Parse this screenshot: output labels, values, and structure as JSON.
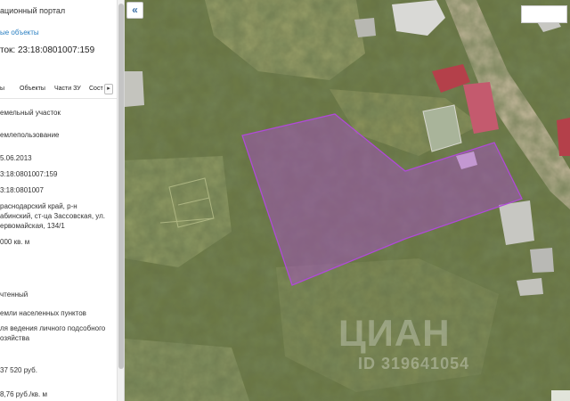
{
  "panel": {
    "portal_title": "ационный портал",
    "nearby_link": "ые объекты",
    "parcel_title": "ток: 23:18:0801007:159",
    "tabs": [
      "ы",
      "Объекты",
      "Части ЗУ",
      "Сост"
    ],
    "tab_scroll_glyph": "▸",
    "fields": [
      "емельный участок",
      "емлепользование",
      "5.06.2013",
      "3:18:0801007:159",
      "3:18:0801007",
      "раснодарский край, р-н",
      "абинский, ст-ца Зассовская, ул.",
      "ервомайская, 134/1",
      "000 кв. м",
      "чтенный",
      "емли населенных пунктов",
      "ля ведения личного подсобного",
      "озяйства",
      "37 520 руб.",
      "8,76 руб./кв. м"
    ]
  },
  "map": {
    "collapse_glyph": "«",
    "parcel_color": "#b04ad8",
    "watermark_brand": "ЦИАН",
    "watermark_id": "ID 319641054"
  }
}
